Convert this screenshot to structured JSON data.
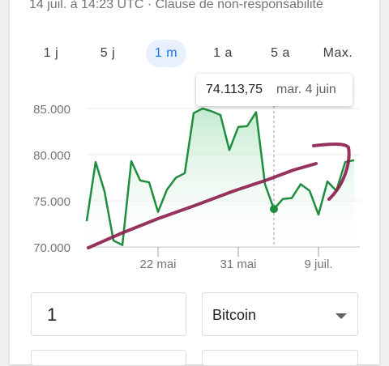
{
  "header": {
    "timestamp": "14 juil. à 14:23 UTC · Clause de non-responsabilité"
  },
  "range_tabs": [
    {
      "label": "1 j",
      "active": false
    },
    {
      "label": "5 j",
      "active": false
    },
    {
      "label": "1 m",
      "active": true
    },
    {
      "label": "1 a",
      "active": false
    },
    {
      "label": "5 a",
      "active": false
    },
    {
      "label": "Max.",
      "active": false
    }
  ],
  "tooltip": {
    "price": "74.113,75",
    "date": "mar. 4 juin"
  },
  "colors": {
    "line": "#1e8e3e",
    "area_top": "#b8e6c6",
    "active_tab_bg": "#e8f0fe",
    "active_tab_text": "#1a73e8",
    "annotation": "#8b1d4e"
  },
  "chart_data": {
    "type": "area",
    "ylim": [
      70000,
      85000
    ],
    "grid": true,
    "y_ticks": [
      {
        "value": 70000,
        "label": "70.000"
      },
      {
        "value": 75000,
        "label": "75.000"
      },
      {
        "value": 80000,
        "label": "80.000"
      },
      {
        "value": 85000,
        "label": "85.000"
      }
    ],
    "x_ticks": [
      {
        "t": 8,
        "label": "22 mai"
      },
      {
        "t": 17,
        "label": "31 mai"
      },
      {
        "t": 26,
        "label": "9 juil."
      }
    ],
    "tmax": 30,
    "series": [
      {
        "x": [
          0,
          1,
          2,
          3,
          4,
          5,
          6,
          7,
          8,
          9,
          10,
          11,
          12,
          13,
          14,
          15,
          16,
          17,
          18,
          19,
          20,
          21,
          22,
          23,
          24,
          25,
          26,
          27,
          28,
          29,
          30
        ],
        "y": [
          72800,
          79200,
          76000,
          70700,
          70200,
          79300,
          77200,
          77000,
          73800,
          76200,
          77500,
          78000,
          84500,
          85000,
          84700,
          84300,
          80500,
          83000,
          83100,
          84600,
          76800,
          74100,
          75200,
          75300,
          76800,
          76100,
          73500,
          77100,
          76100,
          79200,
          79400
        ]
      }
    ],
    "highlight": {
      "x": 21,
      "y": 74113.75
    }
  },
  "converter": {
    "amount_value": "1",
    "currency_label": "Bitcoin"
  }
}
